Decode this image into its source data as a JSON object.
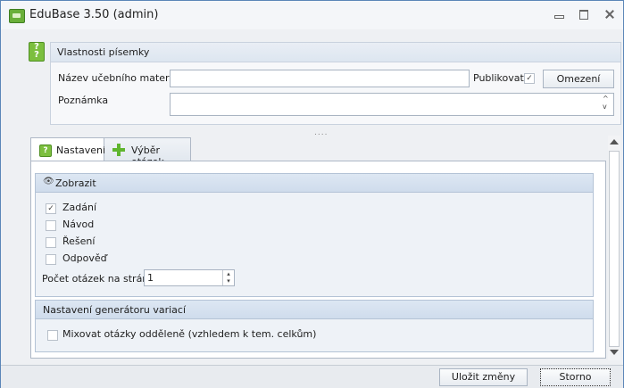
{
  "window": {
    "title": "EduBase 3.50 (admin)"
  },
  "props": {
    "header": "Vlastnosti písemky",
    "name_label": "Název učebního materiálu",
    "name_value": "",
    "publish_label": "Publikovat",
    "publish_checked": true,
    "restrict_button": "Omezení",
    "note_label": "Poznámka",
    "note_value": ""
  },
  "splitter": "....",
  "tabs": [
    {
      "label": "Nastavení",
      "icon": "question-icon",
      "active": true
    },
    {
      "label": "Výběr otázek",
      "icon": "green-plus-icon",
      "active": false
    }
  ],
  "display": {
    "header": "Zobrazit",
    "icon": "eye-icon",
    "options": [
      {
        "label": "Zadání",
        "checked": true
      },
      {
        "label": "Návod",
        "checked": false
      },
      {
        "label": "Řešení",
        "checked": false
      },
      {
        "label": "Odpověď",
        "checked": false
      }
    ],
    "per_page_label": "Počet otázek na stránku",
    "per_page_value": "1"
  },
  "generator": {
    "header": "Nastavení generátoru variací",
    "mix_label": "Mixovat otázky odděleně (vzhledem k tem. celkům)",
    "mix_checked": false
  },
  "footer": {
    "save": "Uložit změny",
    "cancel": "Storno"
  },
  "colors": {
    "accent": "#7cbf3e",
    "border": "#aeb8c6"
  }
}
